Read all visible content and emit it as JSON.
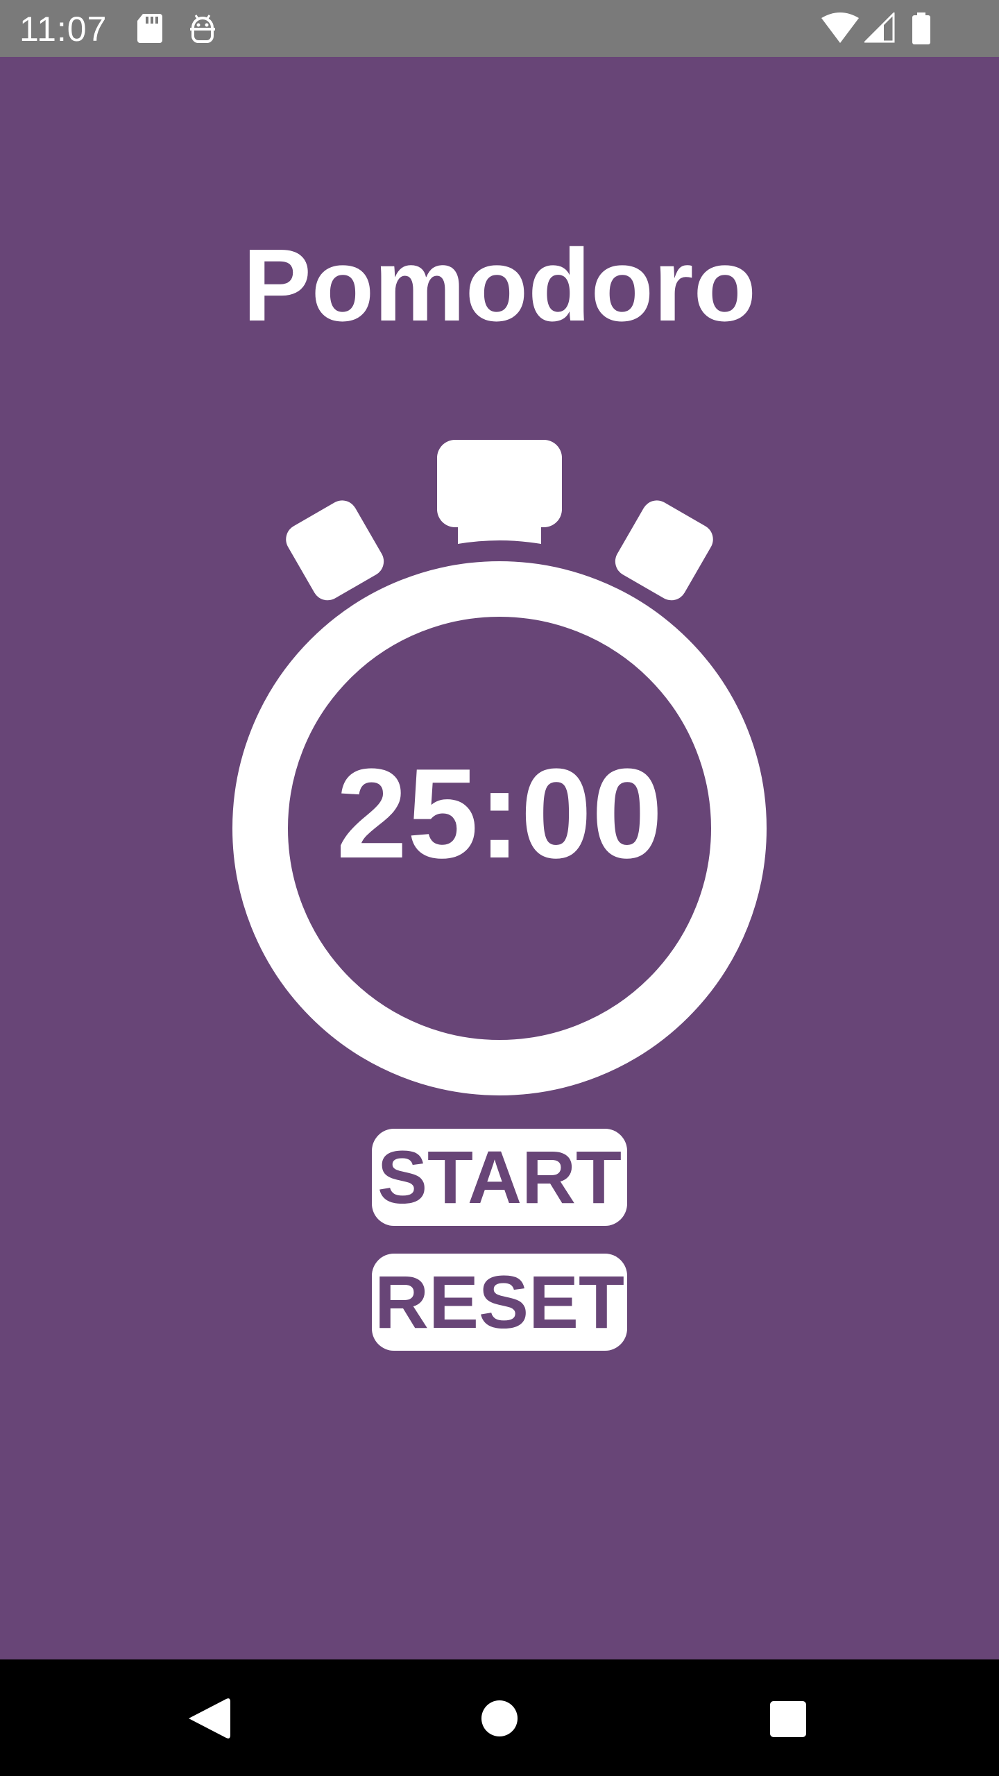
{
  "status_bar": {
    "time": "11:07",
    "icons": [
      "sd-card-icon",
      "debug-icon",
      "wifi-icon",
      "cell-signal-icon",
      "battery-icon"
    ]
  },
  "app": {
    "title": "Pomodoro",
    "timer": "25:00",
    "start_label": "START",
    "reset_label": "RESET",
    "colors": {
      "background": "#684577",
      "foreground": "#ffffff",
      "button_text": "#684577"
    }
  },
  "nav_bar": {
    "buttons": [
      "back-icon",
      "home-icon",
      "recents-icon"
    ]
  }
}
